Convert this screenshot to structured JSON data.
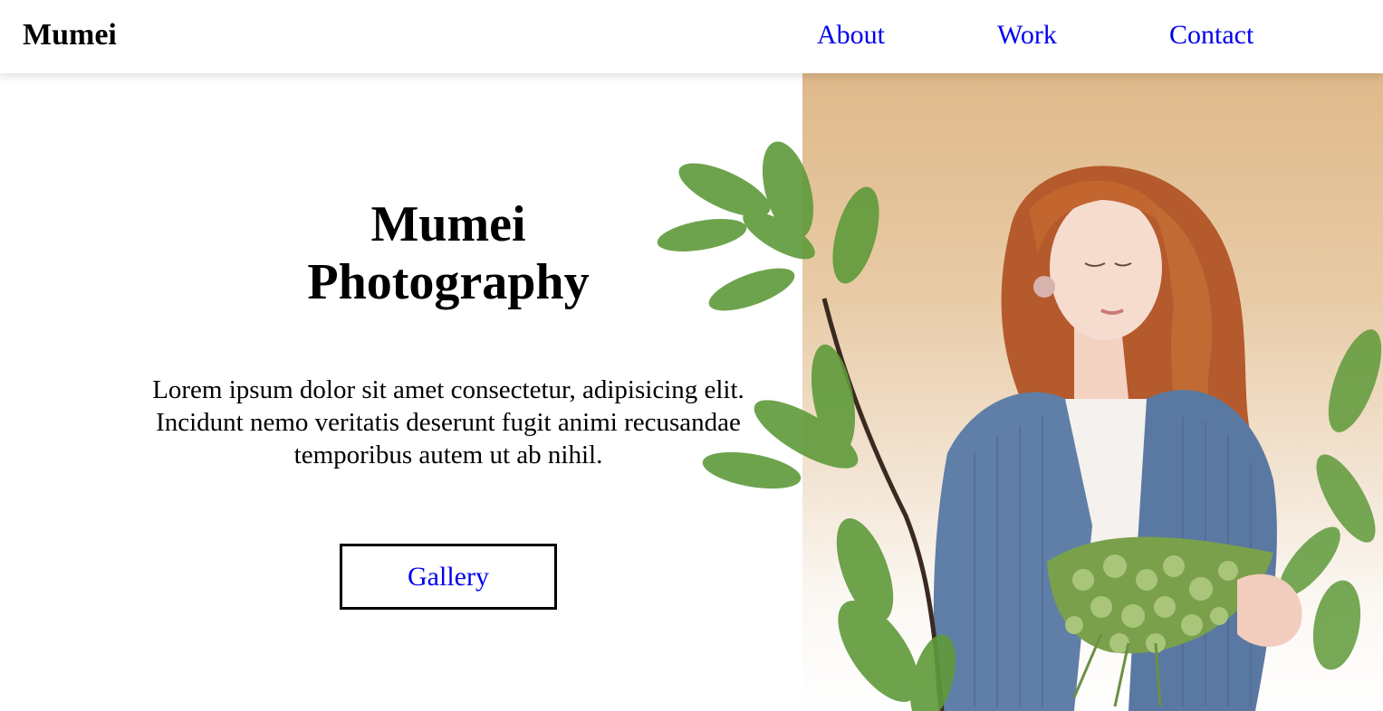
{
  "header": {
    "brand": "Mumei",
    "nav": {
      "about": "About",
      "work": "Work",
      "contact": "Contact"
    }
  },
  "hero": {
    "title_line1": "Mumei",
    "title_line2": "Photography",
    "description": "Lorem ipsum dolor sit amet consectetur, adipisicing elit. Incidunt nemo veritatis deserunt fugit animi recusandae temporibus autem ut ab nihil.",
    "gallery_button": "Gallery"
  },
  "colors": {
    "link": "#0000ee",
    "image_background_top": "#dfb98b",
    "sweater": "#5f7fa8",
    "hair": "#b55a2c",
    "leaf": "#5f9a3a"
  },
  "icons": {
    "hero_photo": "woman-with-flowers-photo"
  }
}
